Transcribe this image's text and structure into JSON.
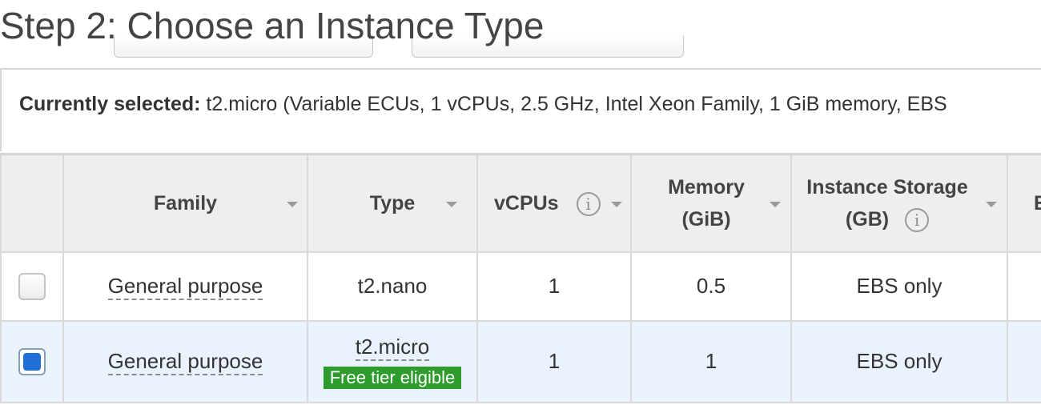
{
  "page": {
    "title": "Step 2: Choose an Instance Type"
  },
  "selection": {
    "label": "Currently selected:",
    "value": " t2.micro (Variable ECUs, 1 vCPUs, 2.5 GHz, Intel Xeon Family, 1 GiB memory, EBS"
  },
  "table": {
    "headers": {
      "family": "Family",
      "type": "Type",
      "vcpus": "vCPUs",
      "memory_line1": "Memory",
      "memory_line2": "(GiB)",
      "storage_line1": "Instance Storage",
      "storage_line2": "(GB)",
      "next_cut": "E"
    },
    "info_icon_glyph": "i",
    "rows": [
      {
        "checked": false,
        "family": "General purpose",
        "type": "t2.nano",
        "vcpus": "1",
        "memory": "0.5",
        "storage": "EBS only"
      },
      {
        "checked": true,
        "family": "General purpose",
        "type": "t2.micro",
        "badge": "Free tier eligible",
        "vcpus": "1",
        "memory": "1",
        "storage": "EBS only"
      }
    ]
  },
  "colors": {
    "selected_row": "#eaf3fd",
    "badge_green": "#2d9c2d",
    "checkbox_blue": "#1f6fd6",
    "header_bg": "#eeeeee"
  },
  "icons": [
    "info-icon",
    "sort-caret-icon",
    "checkbox"
  ]
}
